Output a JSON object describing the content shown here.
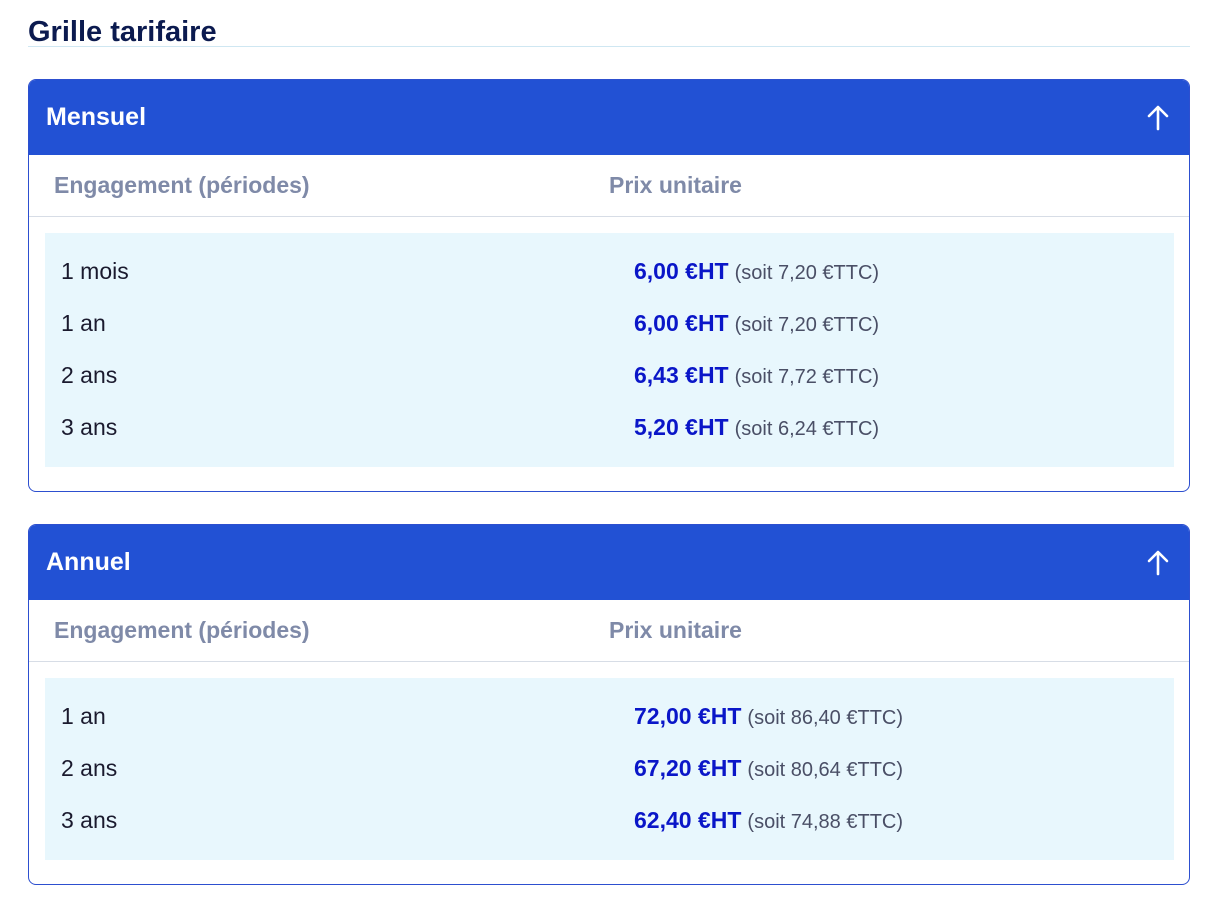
{
  "title": "Grille tarifaire",
  "panels": [
    {
      "title": "Mensuel",
      "toggle_icon": "arrow-up-icon",
      "columns": [
        "Engagement (périodes)",
        "Prix unitaire"
      ],
      "rows": [
        {
          "period": "1 mois",
          "price": "6,00 €HT",
          "ttc": "(soit 7,20 €TTC)"
        },
        {
          "period": "1 an",
          "price": "6,00 €HT",
          "ttc": "(soit 7,20 €TTC)"
        },
        {
          "period": "2 ans",
          "price": "6,43 €HT",
          "ttc": "(soit 7,72 €TTC)"
        },
        {
          "period": "3 ans",
          "price": "5,20 €HT",
          "ttc": "(soit 6,24 €TTC)"
        }
      ]
    },
    {
      "title": "Annuel",
      "toggle_icon": "arrow-up-icon",
      "columns": [
        "Engagement (périodes)",
        "Prix unitaire"
      ],
      "rows": [
        {
          "period": "1 an",
          "price": "72,00 €HT",
          "ttc": "(soit 86,40 €TTC)"
        },
        {
          "period": "2 ans",
          "price": "67,20 €HT",
          "ttc": "(soit 80,64 €TTC)"
        },
        {
          "period": "3 ans",
          "price": "62,40 €HT",
          "ttc": "(soit 74,88 €TTC)"
        }
      ]
    }
  ],
  "colors": {
    "header_bg": "#2251d4",
    "title": "#0b1a4f",
    "price": "#0a16c8",
    "row_bg": "#e8f7fd",
    "column_header": "#7f8aa8"
  }
}
